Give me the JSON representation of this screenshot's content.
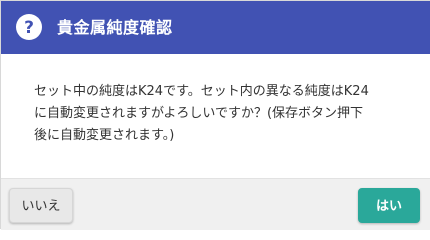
{
  "dialog": {
    "title": "貴金属純度確認",
    "header_icon": "question-circle-icon",
    "message_lines": [
      "セット中の純度はK24です。セット内の異なる純度はK24",
      "に自動変更されますがよろしいですか？(保存ボタン押下",
      "後に自動変更されます。)"
    ],
    "buttons": {
      "no_label": "いいえ",
      "yes_label": "はい"
    }
  },
  "colors": {
    "header_bg": "#4152b3",
    "header_text": "#ffffff",
    "body_text": "#333333",
    "footer_bg": "#f0f0f0",
    "yes_button_bg": "#2aa89a",
    "no_button_bg": "#e8e8e8"
  }
}
